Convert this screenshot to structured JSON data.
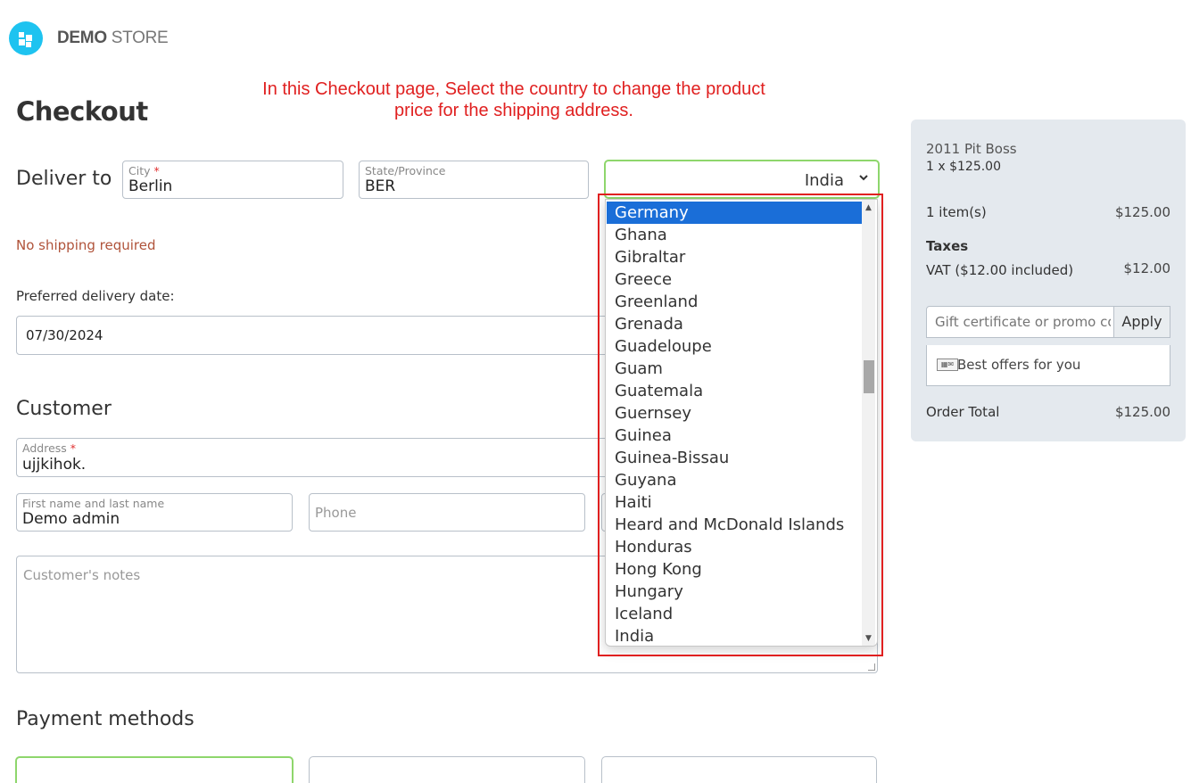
{
  "brand": {
    "name_bold": "DEMO",
    "name_light": "STORE"
  },
  "annotation": "In this Checkout page, Select the country to change the product price for the shipping address.",
  "checkout": {
    "title": "Checkout",
    "deliver_to": "Deliver to",
    "city": {
      "label": "City",
      "required": "*",
      "value": "Berlin"
    },
    "state": {
      "label": "State/Province",
      "value": "BER"
    },
    "country": {
      "value": "India"
    },
    "no_shipping": "No shipping required",
    "preferred_date_label": "Preferred delivery date:",
    "preferred_date_value": "07/30/2024",
    "customer_title": "Customer",
    "address": {
      "label": "Address",
      "required": "*",
      "value": "ujjkihok."
    },
    "name": {
      "label": "First name and last name",
      "value": "Demo admin"
    },
    "phone": {
      "placeholder": "Phone"
    },
    "notes": {
      "placeholder": "Customer's notes"
    },
    "payment_title": "Payment methods"
  },
  "country_dropdown": {
    "selected": "Germany",
    "items": [
      "Germany",
      "Ghana",
      "Gibraltar",
      "Greece",
      "Greenland",
      "Grenada",
      "Guadeloupe",
      "Guam",
      "Guatemala",
      "Guernsey",
      "Guinea",
      "Guinea-Bissau",
      "Guyana",
      "Haiti",
      "Heard and McDonald Islands",
      "Honduras",
      "Hong Kong",
      "Hungary",
      "Iceland",
      "India"
    ]
  },
  "summary": {
    "product_name": "2011 Pit Boss",
    "product_qty": "1 x $125.00",
    "items_label": "1 item(s)",
    "items_total": "$125.00",
    "taxes_title": "Taxes",
    "vat_label": "VAT ($12.00 included)",
    "vat_value": "$12.00",
    "promo_placeholder": "Gift certificate or promo code",
    "apply_label": "Apply",
    "offers_label": "Best offers for you",
    "order_total_label": "Order Total",
    "order_total_value": "$125.00"
  },
  "colors": {
    "accent": "#1ec3f0",
    "selected": "#1a6ed8",
    "annotation": "#e02020",
    "focus": "#8ed66c"
  }
}
